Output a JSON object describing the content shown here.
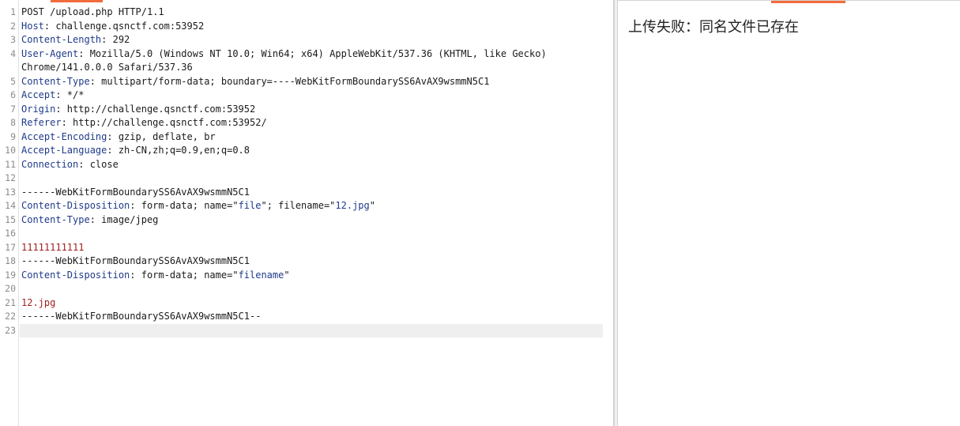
{
  "request": {
    "lines": [
      {
        "n": "1",
        "parts": [
          {
            "t": "POST /upload.php HTTP/1.1",
            "c": "val"
          }
        ]
      },
      {
        "n": "2",
        "parts": [
          {
            "t": "Host",
            "c": "hdr"
          },
          {
            "t": ": challenge.qsnctf.com:53952",
            "c": "val"
          }
        ]
      },
      {
        "n": "3",
        "parts": [
          {
            "t": "Content-Length",
            "c": "hdr"
          },
          {
            "t": ": 292",
            "c": "val"
          }
        ]
      },
      {
        "n": "4",
        "parts": [
          {
            "t": "User-Agent",
            "c": "hdr"
          },
          {
            "t": ": Mozilla/5.0 (Windows NT 10.0; Win64; x64) AppleWebKit/537.36 (KHTML, like Gecko)",
            "c": "val"
          }
        ]
      },
      {
        "n": "",
        "parts": [
          {
            "t": "Chrome/141.0.0.0 Safari/537.36",
            "c": "val"
          }
        ]
      },
      {
        "n": "5",
        "parts": [
          {
            "t": "Content-Type",
            "c": "hdr"
          },
          {
            "t": ": multipart/form-data; boundary=----WebKitFormBoundarySS6AvAX9wsmmN5C1",
            "c": "val"
          }
        ]
      },
      {
        "n": "6",
        "parts": [
          {
            "t": "Accept",
            "c": "hdr"
          },
          {
            "t": ": */*",
            "c": "val"
          }
        ]
      },
      {
        "n": "7",
        "parts": [
          {
            "t": "Origin",
            "c": "hdr"
          },
          {
            "t": ": http://challenge.qsnctf.com:53952",
            "c": "val"
          }
        ]
      },
      {
        "n": "8",
        "parts": [
          {
            "t": "Referer",
            "c": "hdr"
          },
          {
            "t": ": http://challenge.qsnctf.com:53952/",
            "c": "val"
          }
        ]
      },
      {
        "n": "9",
        "parts": [
          {
            "t": "Accept-Encoding",
            "c": "hdr"
          },
          {
            "t": ": gzip, deflate, br",
            "c": "val"
          }
        ]
      },
      {
        "n": "10",
        "parts": [
          {
            "t": "Accept-Language",
            "c": "hdr"
          },
          {
            "t": ": zh-CN,zh;q=0.9,en;q=0.8",
            "c": "val"
          }
        ]
      },
      {
        "n": "11",
        "parts": [
          {
            "t": "Connection",
            "c": "hdr"
          },
          {
            "t": ": close",
            "c": "val"
          }
        ]
      },
      {
        "n": "12",
        "parts": []
      },
      {
        "n": "13",
        "parts": [
          {
            "t": "------WebKitFormBoundarySS6AvAX9wsmmN5C1",
            "c": "val"
          }
        ]
      },
      {
        "n": "14",
        "parts": [
          {
            "t": "Content-Disposition",
            "c": "hdr"
          },
          {
            "t": ": form-data; name=\"",
            "c": "val"
          },
          {
            "t": "file",
            "c": "str"
          },
          {
            "t": "\"; filename=\"",
            "c": "val"
          },
          {
            "t": "12.jpg",
            "c": "str"
          },
          {
            "t": "\"",
            "c": "val"
          }
        ]
      },
      {
        "n": "15",
        "parts": [
          {
            "t": "Content-Type",
            "c": "hdr"
          },
          {
            "t": ": image/jpeg",
            "c": "val"
          }
        ]
      },
      {
        "n": "16",
        "parts": []
      },
      {
        "n": "17",
        "parts": [
          {
            "t": "11111111111",
            "c": "body-red"
          }
        ]
      },
      {
        "n": "18",
        "parts": [
          {
            "t": "------WebKitFormBoundarySS6AvAX9wsmmN5C1",
            "c": "val"
          }
        ]
      },
      {
        "n": "19",
        "parts": [
          {
            "t": "Content-Disposition",
            "c": "hdr"
          },
          {
            "t": ": form-data; name=\"",
            "c": "val"
          },
          {
            "t": "filename",
            "c": "str"
          },
          {
            "t": "\"",
            "c": "val"
          }
        ]
      },
      {
        "n": "20",
        "parts": []
      },
      {
        "n": "21",
        "parts": [
          {
            "t": "12.jpg",
            "c": "body-red"
          }
        ]
      },
      {
        "n": "22",
        "parts": [
          {
            "t": "------WebKitFormBoundarySS6AvAX9wsmmN5C1--",
            "c": "val"
          }
        ]
      },
      {
        "n": "23",
        "parts": [],
        "current": true
      }
    ]
  },
  "response": {
    "message": "上传失败：同名文件已存在"
  },
  "colors": {
    "accent": "#f26b3a",
    "header_name": "#1f3a8a",
    "body_value": "#a02020"
  }
}
